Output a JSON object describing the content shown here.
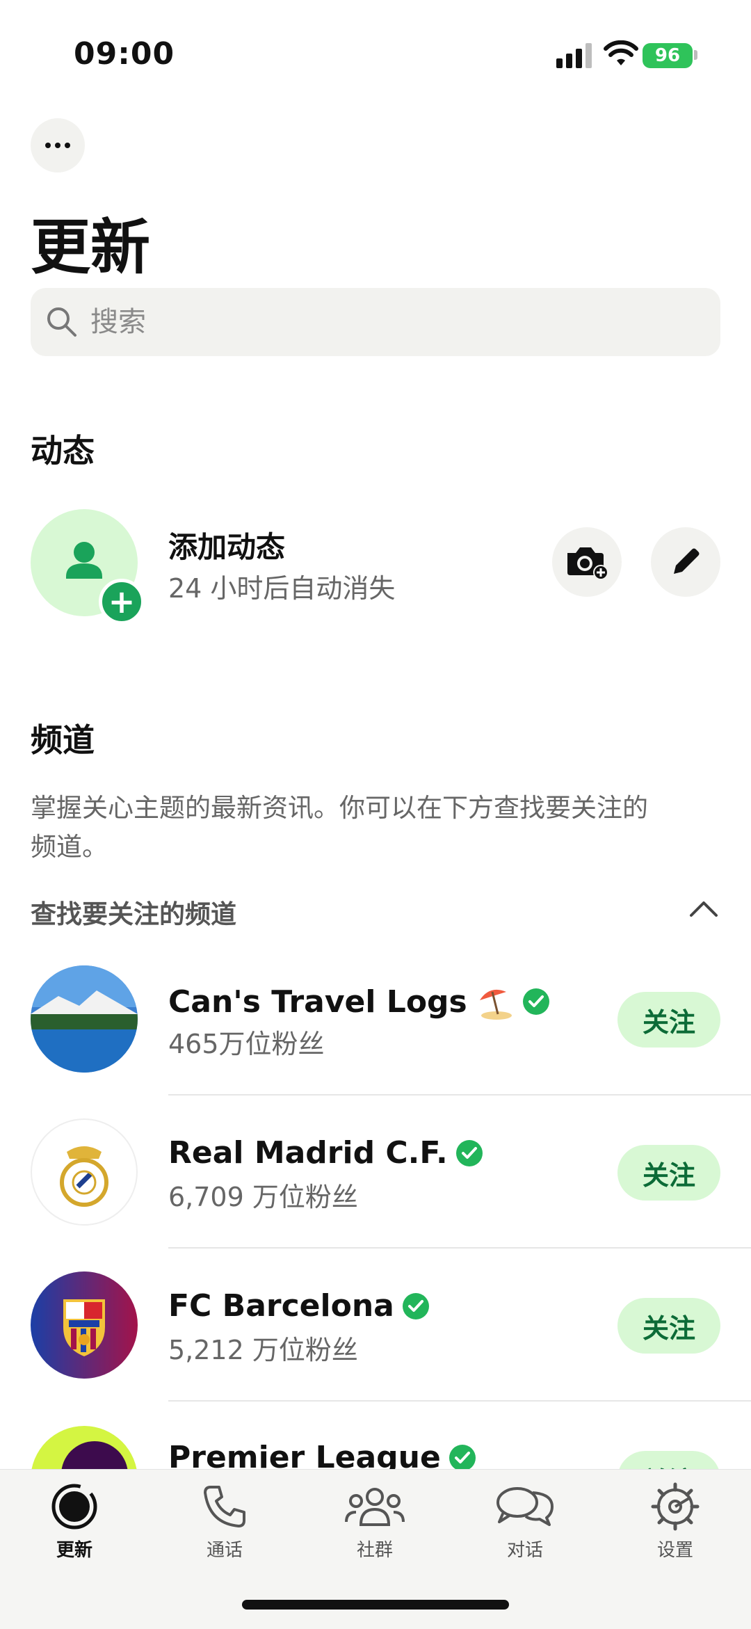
{
  "status_bar": {
    "time": "09:00",
    "battery": "96"
  },
  "header": {
    "title": "更新"
  },
  "search": {
    "placeholder": "搜索"
  },
  "status_section": {
    "title": "动态",
    "add_title": "添加动态",
    "add_subtitle": "24 小时后自动消失"
  },
  "channels_section": {
    "title": "频道",
    "description": "掌握关心主题的最新资讯。你可以在下方查找要关注的频道。",
    "find_title": "查找要关注的频道",
    "items": [
      {
        "name": "Can's Travel Logs",
        "subtitle": "465万位粉丝",
        "follow_label": "关注"
      },
      {
        "name": "Real Madrid C.F.",
        "subtitle": "6,709 万位粉丝",
        "follow_label": "关注"
      },
      {
        "name": "FC Barcelona",
        "subtitle": "5,212 万位粉丝",
        "follow_label": "关注"
      },
      {
        "name": "Premier League",
        "subtitle": "",
        "follow_label": "关注"
      }
    ]
  },
  "tab_bar": {
    "tabs": [
      {
        "label": "更新",
        "icon": "updates-icon",
        "active": true
      },
      {
        "label": "通话",
        "icon": "phone-icon"
      },
      {
        "label": "社群",
        "icon": "communities-icon"
      },
      {
        "label": "对话",
        "icon": "chats-icon"
      },
      {
        "label": "设置",
        "icon": "settings-icon"
      }
    ]
  },
  "colors": {
    "accent": "#1aa35a",
    "accent_light": "#d8f8d4",
    "follow_text": "#0c6b37"
  }
}
